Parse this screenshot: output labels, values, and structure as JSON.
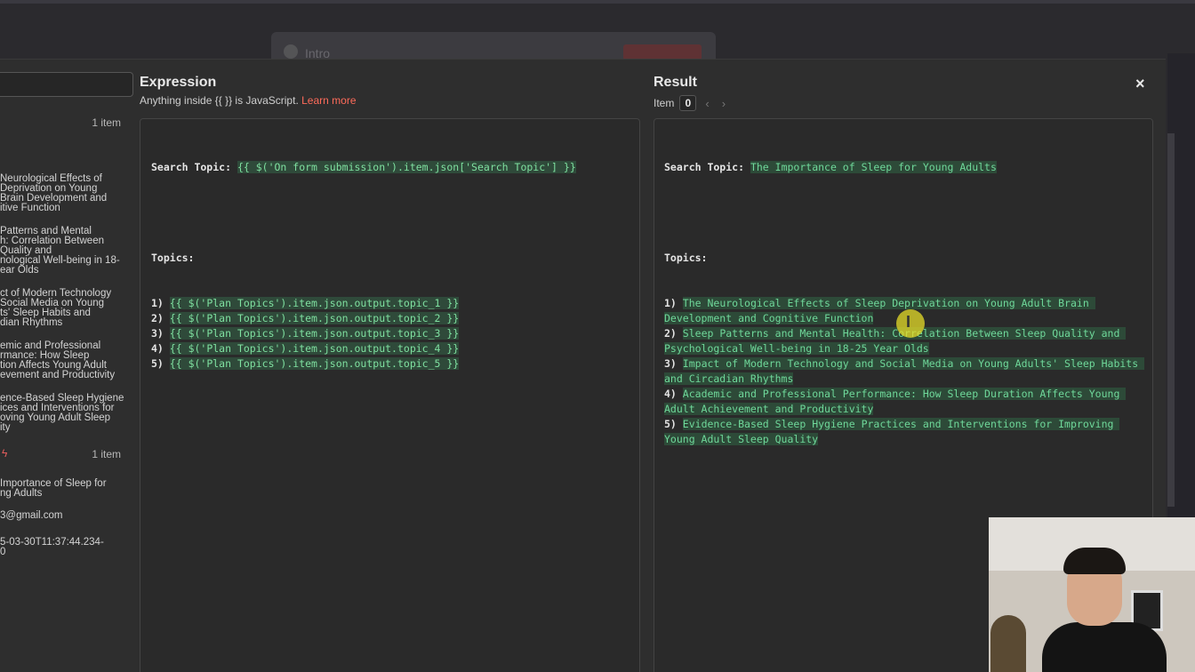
{
  "background": {
    "node_label": "Intro"
  },
  "left_panel": {
    "count_top": "1 item",
    "lines": [
      "Neurological Effects of",
      "Deprivation on Young",
      "Brain Development and",
      "itive Function",
      "Patterns and Mental",
      "h: Correlation Between",
      "Quality and",
      "nological Well-being in 18-",
      "ear Olds",
      "ct of Modern Technology",
      "Social Media on Young",
      "ts' Sleep Habits and",
      "dian Rhythms",
      "emic and Professional",
      "rmance: How Sleep",
      "tion Affects Young Adult",
      "evement and Productivity",
      "ence-Based Sleep Hygiene",
      "ices and Interventions for",
      "oving Young Adult Sleep",
      "ity"
    ],
    "count_bottom": "1 item",
    "topic_lines": [
      "Importance of Sleep for",
      "ng Adults"
    ],
    "email": "3@gmail.com",
    "timestamp_lines": [
      "5-03-30T11:37:44.234-",
      "0"
    ]
  },
  "expression": {
    "title": "Expression",
    "hint_prefix": "Anything inside {{  }} is JavaScript.",
    "learn_more": "Learn more",
    "search_label": "Search Topic:",
    "search_expr": "{{ $('On form submission').item.json['Search Topic'] }}",
    "topics_label": "Topics:",
    "topics": [
      {
        "num": "1)",
        "expr": "{{ $('Plan Topics').item.json.output.topic_1 }}"
      },
      {
        "num": "2)",
        "expr": "{{ $('Plan Topics').item.json.output.topic_2 }}"
      },
      {
        "num": "3)",
        "expr": "{{ $('Plan Topics').item.json.output.topic_3 }}"
      },
      {
        "num": "4)",
        "expr": "{{ $('Plan Topics').item.json.output.topic_4 }}"
      },
      {
        "num": "5)",
        "expr": "{{ $('Plan Topics').item.json.output.topic_5 }}"
      }
    ]
  },
  "result": {
    "title": "Result",
    "item_label": "Item",
    "item_index": "0",
    "search_label": "Search Topic:",
    "search_value": "The Importance of Sleep for Young Adults",
    "topics_label": "Topics:",
    "topics": [
      {
        "num": "1)",
        "value": "The Neurological Effects of Sleep Deprivation on Young Adult Brain Development and Cognitive Function"
      },
      {
        "num": "2)",
        "value": "Sleep Patterns and Mental Health: Correlation Between Sleep Quality and Psychological Well-being in 18-25 Year Olds"
      },
      {
        "num": "3)",
        "value": "Impact of Modern Technology and Social Media on Young Adults' Sleep Habits and Circadian Rhythms"
      },
      {
        "num": "4)",
        "value": "Academic and Professional Performance: How Sleep Duration Affects Young Adult Achievement and Productivity"
      },
      {
        "num": "5)",
        "value": "Evidence-Based Sleep Hygiene Practices and Interventions for Improving Young Adult Sleep Quality"
      }
    ]
  },
  "close_icon": "×"
}
